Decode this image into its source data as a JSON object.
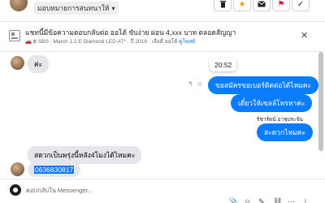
{
  "header": {
    "assign_label": "มอบหมายการสนทนาให้",
    "actions": [
      "trash-icon",
      "star-icon",
      "mail-icon",
      "flag-icon",
      "check-icon"
    ]
  },
  "listing": {
    "title": "แชทนี้มีข้อความตอบกลับต่อ ออโต้ ขับง่าย ผ่อน 4,xxx บาท ตลอดสัญญา",
    "meta_car": "🚗 ฿ SBS · March 1.2 E Diamond LED AT* · ปี 2019 · เลือดี ออโต้",
    "meta_link": "ดูโพสต์",
    "close_icon": "close-icon"
  },
  "messages": {
    "m1": "ค่ะ",
    "time": "20:52",
    "out1": "ขอสมัครขอเบอร์ติดต่อได้ไหมคะ",
    "out2": "เดี๋ยวให้เซลล์โทรหาค่ะ",
    "sender_name": "ริชาร์ดน์ อาชประจัน",
    "out3": "สะดวกไหมคะ",
    "in2": "สดวกเป็นพรุ่งนี้หลัง4โมงได้ไหมคะ",
    "phone": "0636830817"
  },
  "composer": {
    "placeholder": "ตอบกลับใน Messenger..."
  },
  "colors": {
    "accent": "#0a7cff",
    "incoming": "#e4e6eb",
    "selection": "#1877f2"
  }
}
